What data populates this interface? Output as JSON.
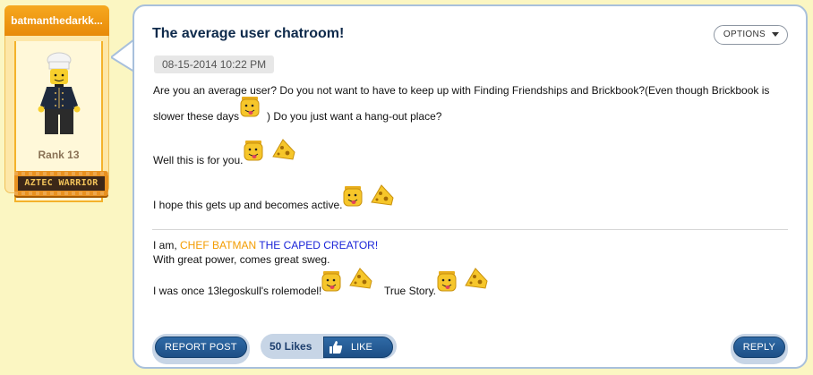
{
  "user": {
    "username": "batmanthedarkk...",
    "rank": "Rank 13",
    "rank_badge": "AZTEC WARRIOR",
    "avatar_icon": "chef-minifigure-icon"
  },
  "post": {
    "title": "The average user chatroom!",
    "options_label": "OPTIONS",
    "date": "08-15-2014 10:22 PM",
    "line1": "Are you an average user? Do you not want to have to keep up with Finding Friendships and Brickbook?(Even though Brickbook is",
    "line2a": "slower these days",
    "line2b": ") Do you just want a hang-out place?",
    "line3": "Well this is for you.",
    "line4": "I hope this gets up and becomes active.",
    "signature": {
      "prefix": "I am, ",
      "chef": "CHEF BATMAN",
      "caped": " THE CAPED CREATOR!",
      "line2": "With great power, comes great sweg.",
      "line3a": "I was once 13legoskull's rolemodel!",
      "line3b": "True Story."
    }
  },
  "actions": {
    "report": "REPORT POST",
    "likes": "50 Likes",
    "like": "LIKE",
    "reply": "REPLY"
  },
  "colors": {
    "accent_blue": "#1d4f86",
    "chef_orange": "#f39c00",
    "caped_blue": "#1b25d8"
  }
}
